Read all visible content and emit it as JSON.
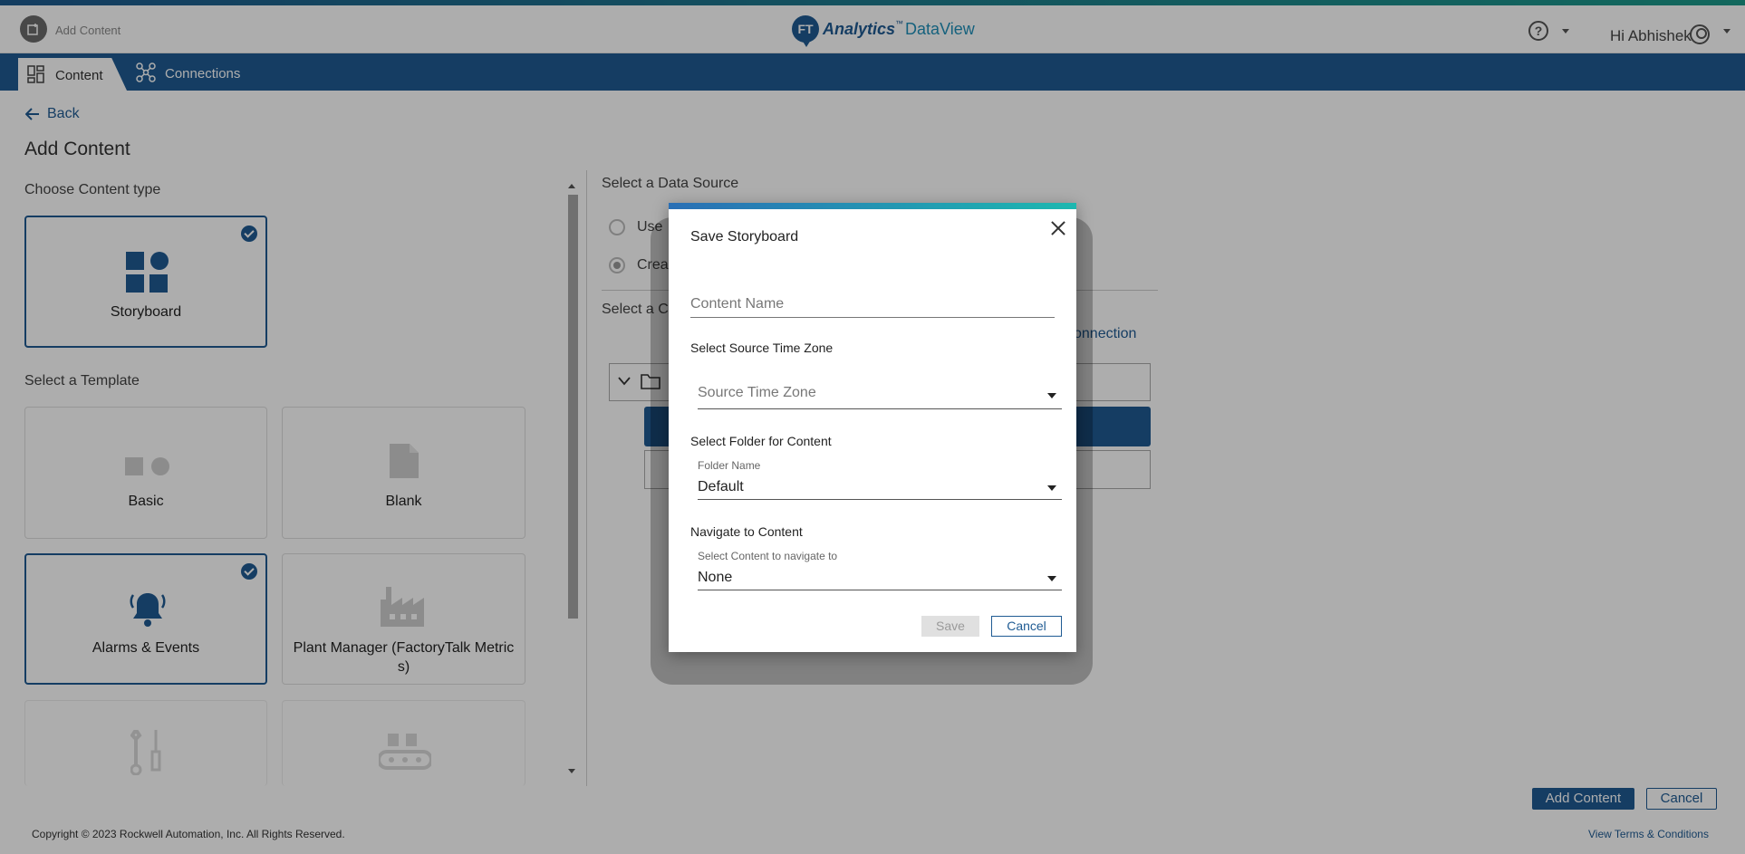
{
  "header": {
    "crumb_label": "Add Content",
    "logo_badge": "FT",
    "logo_analytics": "Analytics",
    "logo_tm": "™",
    "logo_dataview": "DataView",
    "greeting": "Hi Abhishek"
  },
  "nav": {
    "tabs": [
      {
        "label": "Content",
        "icon": "grid-icon"
      },
      {
        "label": "Connections",
        "icon": "network-icon"
      }
    ]
  },
  "page": {
    "back_label": "Back",
    "title": "Add Content",
    "content_type_label": "Choose Content type",
    "content_types": [
      {
        "label": "Storyboard",
        "selected": true
      }
    ],
    "template_label": "Select a Template",
    "templates": [
      {
        "label": "Basic",
        "selected": false
      },
      {
        "label": "Blank",
        "selected": false
      },
      {
        "label": "Alarms & Events",
        "selected": true
      },
      {
        "label": "Plant Manager (FactoryTalk Metric\ns)",
        "selected": false
      }
    ],
    "data_source_label": "Select a Data Source",
    "radio_use": "Use",
    "radio_create": "Crea",
    "select_c_label": "Select a C",
    "connection_link": "onnection"
  },
  "footer": {
    "add_button": "Add Content",
    "cancel_button": "Cancel",
    "copyright": "Copyright © 2023 Rockwell Automation, Inc. All Rights Reserved.",
    "terms": "View Terms & Conditions"
  },
  "dialog": {
    "title": "Save Storyboard",
    "content_name_placeholder": "Content Name",
    "time_zone_section": "Select Source Time Zone",
    "time_zone_placeholder": "Source Time Zone",
    "folder_section": "Select Folder for Content",
    "folder_label": "Folder Name",
    "folder_value": "Default",
    "navigate_section": "Navigate to Content",
    "navigate_label": "Select Content to navigate to",
    "navigate_value": "None",
    "save_button": "Save",
    "cancel_button": "Cancel"
  },
  "colors": {
    "brand": "#1f5b93",
    "accent": "#1db8b0"
  }
}
